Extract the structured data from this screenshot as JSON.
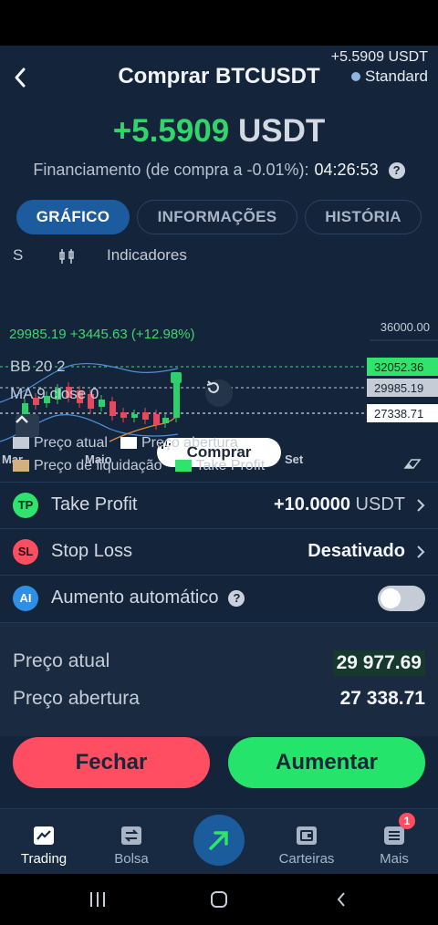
{
  "header": {
    "title": "Comprar BTCUSDT",
    "top_amount": "+5.5909 USDT",
    "mode": "Standard"
  },
  "summary": {
    "profit_value": "+5.5909",
    "profit_currency": "USDT",
    "funding_label": "Financiamento (de compra a -0.01%):",
    "funding_time": "04:26:53"
  },
  "tabs": [
    {
      "label": "GRÁFICO",
      "active": true
    },
    {
      "label": "INFORMAÇÕES",
      "active": false
    },
    {
      "label": "HISTÓRIA",
      "active": false
    }
  ],
  "chart_toolbar": {
    "timeframe": "S",
    "indicators_label": "Indicadores"
  },
  "chart_data": {
    "type": "line",
    "stat_line": "29985.19  +3445.63 (+12.98%)",
    "indicator_bb": "BB 20 2",
    "indicator_ma": "MA 9 close 0",
    "y_axis_top": "36000.00",
    "price_tags": {
      "take_profit": "32052.36",
      "current": "29985.19",
      "open": "27338.71"
    },
    "x_ticks": [
      "Mar",
      "Maio",
      "Set"
    ],
    "buy_label": "Comprar",
    "legend": [
      {
        "label": "Preço atual",
        "color": "#c6ccd5"
      },
      {
        "label": "Preço abertura",
        "color": "#ffffff"
      },
      {
        "label": "Preço de liquidação",
        "color": "#d3b07f"
      },
      {
        "label": "Take Profit",
        "color": "#2fe36d"
      }
    ]
  },
  "settings": {
    "take_profit": {
      "label": "Take Profit",
      "badge": "TP",
      "value": "+10.0000",
      "unit": "USDT",
      "color": "#2fe36d"
    },
    "stop_loss": {
      "label": "Stop Loss",
      "badge": "SL",
      "value": "Desativado",
      "color": "#ff4d62"
    },
    "auto_increase": {
      "label": "Aumento automático",
      "badge": "AI",
      "enabled": false,
      "color": "#2f8fe6"
    }
  },
  "prices": {
    "current_label": "Preço atual",
    "current_value": "29 977.69",
    "open_label": "Preço abertura",
    "open_value": "27 338.71"
  },
  "actions": {
    "close_label": "Fechar",
    "increase_label": "Aumentar"
  },
  "tabbar": {
    "items": [
      "Trading",
      "Bolsa",
      "Carteiras",
      "Mais"
    ],
    "notification_count": "1"
  }
}
